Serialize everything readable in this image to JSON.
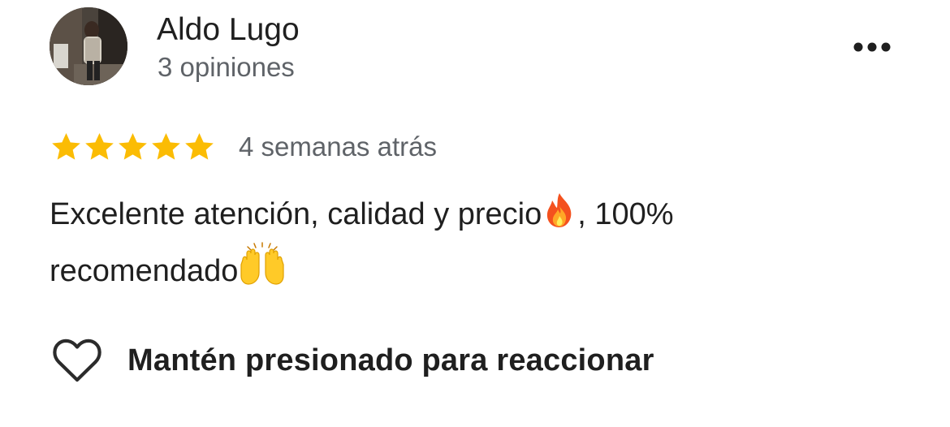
{
  "author": {
    "name": "Aldo Lugo",
    "review_count": "3 opiniones",
    "avatar_icon": "user-photo"
  },
  "menu": {
    "icon": "more-horizontal-icon"
  },
  "review": {
    "rating": 5,
    "rating_max": 5,
    "time": "4 semanas atrás",
    "text_line1_part1": "Excelente atención, calidad y precio",
    "text_line1_emoji": "🔥",
    "text_line1_part2": ", 100%",
    "text_line2_part1": "recomendado",
    "text_line2_emoji": "🙌"
  },
  "actions": {
    "react_label": "Mantén presionado para reaccionar",
    "react_icon": "heart-outline-icon"
  },
  "colors": {
    "star": "#fbbc04",
    "text_primary": "#1f1f1f",
    "text_secondary": "#5f6368"
  }
}
